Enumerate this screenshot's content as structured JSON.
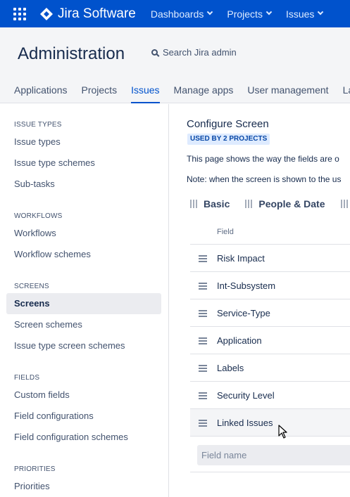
{
  "topbar": {
    "brand": "Jira Software",
    "nav": [
      {
        "label": "Dashboards"
      },
      {
        "label": "Projects"
      },
      {
        "label": "Issues"
      }
    ],
    "color": "#0052cc"
  },
  "admin": {
    "title": "Administration",
    "search_label": "Search Jira admin",
    "tabs": [
      {
        "label": "Applications"
      },
      {
        "label": "Projects"
      },
      {
        "label": "Issues",
        "active": true
      },
      {
        "label": "Manage apps"
      },
      {
        "label": "User management"
      },
      {
        "label": "Lat"
      }
    ]
  },
  "sidebar": {
    "sections": [
      {
        "title": "ISSUE TYPES",
        "items": [
          "Issue types",
          "Issue type schemes",
          "Sub-tasks"
        ]
      },
      {
        "title": "WORKFLOWS",
        "items": [
          "Workflows",
          "Workflow schemes"
        ]
      },
      {
        "title": "SCREENS",
        "items": [
          "Screens",
          "Screen schemes",
          "Issue type screen schemes"
        ]
      },
      {
        "title": "FIELDS",
        "items": [
          "Custom fields",
          "Field configurations",
          "Field configuration schemes"
        ]
      },
      {
        "title": "PRIORITIES",
        "items": [
          "Priorities"
        ]
      }
    ],
    "active_item": "Screens"
  },
  "main": {
    "title": "Configure Screen",
    "badge": "USED BY 2 PROJECTS",
    "description": "This page shows the way the fields are o",
    "note": "Note: when the screen is shown to the us",
    "screen_tabs": [
      "Basic",
      "People & Date",
      ""
    ],
    "table_header": "Field",
    "fields": [
      "Risk Impact",
      "Int-Subsystem",
      "Service-Type",
      "Application",
      "Labels",
      "Security Level",
      "Linked Issues"
    ],
    "hovered_field": "Linked Issues",
    "field_input_placeholder": "Field name"
  }
}
